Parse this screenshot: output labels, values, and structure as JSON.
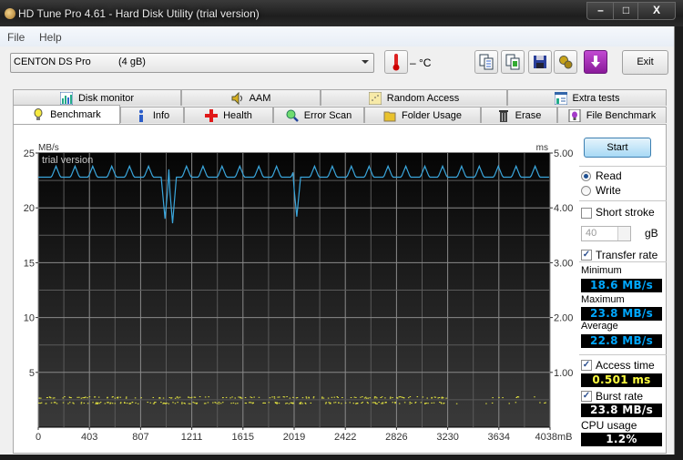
{
  "window": {
    "title": "HD Tune Pro 4.61 - Hard Disk Utility (trial version)",
    "controls": {
      "minimize": "–",
      "maximize": "□",
      "close": "X"
    }
  },
  "menu": {
    "file": "File",
    "help": "Help"
  },
  "toolbar": {
    "drive_name": "CENTON  DS Pro",
    "drive_size": "(4 gB)",
    "temperature": "– °C",
    "exit_label": "Exit",
    "icons": [
      "copy-text-icon",
      "copy-screenshot-icon",
      "save-icon",
      "options-icon",
      "download-icon"
    ]
  },
  "tabs": {
    "row1": [
      {
        "label": "Disk monitor",
        "icon": "disk-monitor-icon"
      },
      {
        "label": "AAM",
        "icon": "speaker-icon"
      },
      {
        "label": "Random Access",
        "icon": "random-access-icon"
      },
      {
        "label": "Extra tests",
        "icon": "extra-tests-icon"
      }
    ],
    "row2": [
      {
        "label": "Benchmark",
        "icon": "lightbulb-icon",
        "active": true
      },
      {
        "label": "Info",
        "icon": "info-icon"
      },
      {
        "label": "Health",
        "icon": "health-cross-icon"
      },
      {
        "label": "Error Scan",
        "icon": "magnifier-icon"
      },
      {
        "label": "Folder Usage",
        "icon": "folder-icon"
      },
      {
        "label": "Erase",
        "icon": "trash-icon"
      },
      {
        "label": "File Benchmark",
        "icon": "file-benchmark-icon"
      }
    ]
  },
  "sidebar": {
    "start_label": "Start",
    "read_label": "Read",
    "write_label": "Write",
    "mode": "read",
    "short_stroke_label": "Short stroke",
    "short_stroke_checked": false,
    "short_stroke_value": "40",
    "short_stroke_unit": "gB",
    "transfer_rate_label": "Transfer rate",
    "transfer_rate_checked": true,
    "minimum_label": "Minimum",
    "minimum_value": "18.6 MB/s",
    "maximum_label": "Maximum",
    "maximum_value": "23.8 MB/s",
    "average_label": "Average",
    "average_value": "22.8 MB/s",
    "access_time_label": "Access time",
    "access_time_checked": true,
    "access_time_value": "0.501 ms",
    "burst_rate_label": "Burst rate",
    "burst_rate_checked": true,
    "burst_rate_value": "23.8 MB/s",
    "cpu_usage_label": "CPU usage",
    "cpu_usage_value": "1.2%",
    "colors": {
      "transfer": "#00a8ff",
      "access": "#ffff40",
      "burst": "#ffffff"
    }
  },
  "chart_data": {
    "type": "line",
    "title": "",
    "watermark": "trial version",
    "ylabel": "MB/s",
    "y2label": "ms",
    "xunit": "mB",
    "ylim": [
      0,
      25
    ],
    "y2lim": [
      0,
      5
    ],
    "xlim": [
      0,
      4038
    ],
    "y_ticks": [
      5,
      10,
      15,
      20,
      25
    ],
    "y2_ticks": [
      "1.00",
      "2.00",
      "3.00",
      "4.00",
      "5.00"
    ],
    "x_ticks": [
      "0",
      "403",
      "807",
      "1211",
      "1615",
      "2019",
      "2422",
      "2826",
      "3230",
      "3634",
      "4038mB"
    ],
    "grid": true,
    "series": [
      {
        "name": "Transfer rate",
        "color": "#3aa6dc",
        "baseline": 22.8,
        "spike_peak": 23.8,
        "spike_positions": [
          140,
          290,
          430,
          580,
          720,
          870,
          1020,
          1170,
          1300,
          1450,
          1590,
          1740,
          1880,
          2030,
          2180,
          2320,
          2470,
          2610,
          2760,
          2900,
          3050,
          3190,
          3340,
          3480,
          3630,
          3770,
          3920
        ],
        "dips": [
          {
            "x": 1000,
            "y": 19.0
          },
          {
            "x": 1060,
            "y": 18.6
          },
          {
            "x": 2040,
            "y": 19.2
          }
        ]
      },
      {
        "name": "Access time",
        "color": "#e8e840",
        "range_ms": [
          0.45,
          0.55
        ],
        "scatter": true
      }
    ]
  }
}
